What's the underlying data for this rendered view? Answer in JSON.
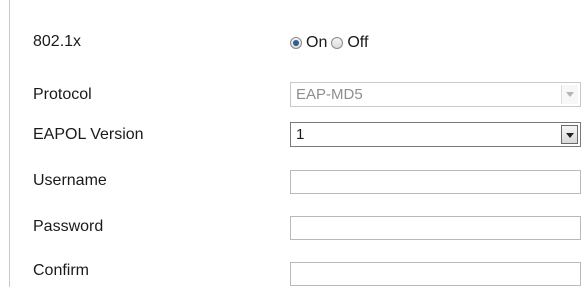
{
  "form": {
    "dot1x": {
      "label": "802.1x",
      "options": [
        "On",
        "Off"
      ],
      "selected": "On"
    },
    "protocol": {
      "label": "Protocol",
      "value": "EAP-MD5",
      "disabled": true
    },
    "eapol_version": {
      "label": "EAPOL Version",
      "value": "1"
    },
    "username": {
      "label": "Username",
      "value": ""
    },
    "password": {
      "label": "Password",
      "value": ""
    },
    "confirm": {
      "label": "Confirm",
      "value": ""
    }
  }
}
